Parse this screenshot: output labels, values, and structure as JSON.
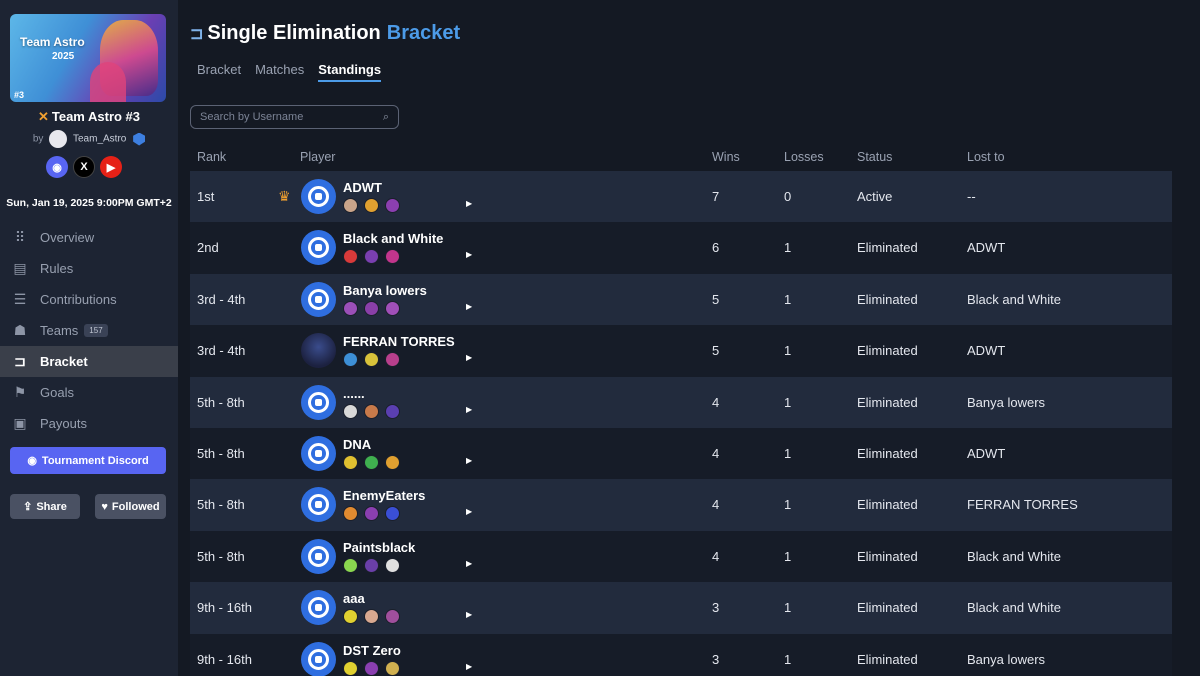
{
  "sidebar": {
    "banner": {
      "title": "Team Astro",
      "year": "2025",
      "number": "#3"
    },
    "tournament_title": "Team Astro #3",
    "byline_prefix": "by",
    "organizer": "Team_Astro",
    "date": "Sun, Jan 19, 2025 9:00PM GMT+2",
    "socials": [
      {
        "name": "discord-icon",
        "color": "#5865f2"
      },
      {
        "name": "x-icon",
        "color": "#000000"
      },
      {
        "name": "youtube-icon",
        "color": "#e62117"
      }
    ],
    "nav": [
      {
        "label": "Overview",
        "icon": "grid-icon"
      },
      {
        "label": "Rules",
        "icon": "rules-icon"
      },
      {
        "label": "Contributions",
        "icon": "coins-icon"
      },
      {
        "label": "Teams",
        "icon": "users-icon",
        "count": "157"
      },
      {
        "label": "Bracket",
        "icon": "bracket-icon",
        "active": true
      },
      {
        "label": "Goals",
        "icon": "flag-icon"
      },
      {
        "label": "Payouts",
        "icon": "money-icon"
      }
    ],
    "discord_button": "Tournament Discord",
    "share_button": "Share",
    "follow_button": "Followed"
  },
  "main": {
    "title": "Single Elimination",
    "title_accent": "Bracket",
    "accent_color": "#4c9be8",
    "tabs": [
      {
        "label": "Bracket"
      },
      {
        "label": "Matches"
      },
      {
        "label": "Standings",
        "active": true
      }
    ],
    "search_placeholder": "Search by Username"
  },
  "standings": {
    "columns": {
      "rank": "Rank",
      "player": "Player",
      "wins": "Wins",
      "losses": "Losses",
      "status": "Status",
      "lost_to": "Lost to"
    },
    "rows": [
      {
        "rank": "1st",
        "player": "ADWT",
        "wins": "7",
        "losses": "0",
        "status": "Active",
        "lost_to": "--",
        "crown": true,
        "minis": [
          "#c9a48a",
          "#e0a030",
          "#8b3fb0"
        ]
      },
      {
        "rank": "2nd",
        "player": "Black and White",
        "wins": "6",
        "losses": "1",
        "status": "Eliminated",
        "lost_to": "ADWT",
        "minis": [
          "#d93a3a",
          "#7a3fb0",
          "#c2358c"
        ]
      },
      {
        "rank": "3rd - 4th",
        "player": "Banya lowers",
        "wins": "5",
        "losses": "1",
        "status": "Eliminated",
        "lost_to": "Black and White",
        "minis": [
          "#9b4fb8",
          "#8a3fa8",
          "#a04fb8"
        ]
      },
      {
        "rank": "3rd - 4th",
        "player": "FERRAN TORRES",
        "wins": "5",
        "losses": "1",
        "status": "Eliminated",
        "lost_to": "ADWT",
        "photo": true,
        "minis": [
          "#3d8fd6",
          "#d8c23a",
          "#b83f8c"
        ]
      },
      {
        "rank": "5th - 8th",
        "player": "......",
        "wins": "4",
        "losses": "1",
        "status": "Eliminated",
        "lost_to": "Banya lowers",
        "minis": [
          "#d8d8d8",
          "#c87a4a",
          "#5a3fb0"
        ]
      },
      {
        "rank": "5th - 8th",
        "player": "DNA",
        "wins": "4",
        "losses": "1",
        "status": "Eliminated",
        "lost_to": "ADWT",
        "minis": [
          "#e0c030",
          "#3fb04f",
          "#e0a030"
        ]
      },
      {
        "rank": "5th - 8th",
        "player": "EnemyEaters",
        "wins": "4",
        "losses": "1",
        "status": "Eliminated",
        "lost_to": "FERRAN TORRES",
        "minis": [
          "#e08a30",
          "#8a3fb0",
          "#3a4fd6"
        ]
      },
      {
        "rank": "5th - 8th",
        "player": "Paintsblack",
        "wins": "4",
        "losses": "1",
        "status": "Eliminated",
        "lost_to": "Black and White",
        "minis": [
          "#8ad64f",
          "#6a3fa8",
          "#e0e0e0"
        ]
      },
      {
        "rank": "9th - 16th",
        "player": "aaa",
        "wins": "3",
        "losses": "1",
        "status": "Eliminated",
        "lost_to": "Black and White",
        "minis": [
          "#e0d030",
          "#d8a890",
          "#a04f9c"
        ]
      },
      {
        "rank": "9th - 16th",
        "player": "DST Zero",
        "wins": "3",
        "losses": "1",
        "status": "Eliminated",
        "lost_to": "Banya lowers",
        "minis": [
          "#e0d030",
          "#8a3fb0",
          "#d0b050"
        ]
      }
    ]
  }
}
